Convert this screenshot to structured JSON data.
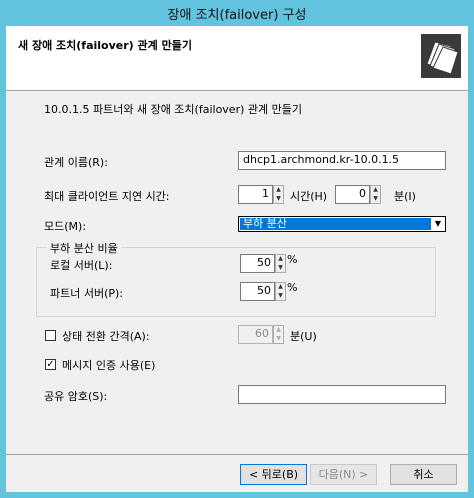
{
  "window": {
    "title": "장애 조치(failover) 구성"
  },
  "header": {
    "title": "새 장애 조치(failover) 관계 만들기",
    "icon": "folders-icon"
  },
  "intro": "10.0.1.5 파트너와 새 장애 조치(failover) 관계 만들기",
  "relationship_name": {
    "label": "관계 이름(R):",
    "value": "dhcp1.archmond.kr-10.0.1.5"
  },
  "max_client_lead_time": {
    "label": "최대 클라이언트 지연 시간:",
    "hours": "1",
    "hours_label": "시간(H)",
    "minutes": "0",
    "minutes_label": "분(I)"
  },
  "mode": {
    "label": "모드(M):",
    "selected": "부하 분산"
  },
  "load_balance": {
    "legend": "부하 분산 비율",
    "local_label": "로컬 서버(L):",
    "local_value": "50",
    "partner_label": "파트너 서버(P):",
    "partner_value": "50",
    "percent": "%"
  },
  "state_switchover": {
    "label": "상태 전환 간격(A):",
    "checked": false,
    "value": "60",
    "unit": "분(U)"
  },
  "message_auth": {
    "label": "메시지 인증 사용(E)",
    "checked": true
  },
  "shared_secret": {
    "label": "공유 암호(S):",
    "value": ""
  },
  "buttons": {
    "back": "< 뒤로(B)",
    "next": "다음(N) >",
    "cancel": "취소"
  }
}
